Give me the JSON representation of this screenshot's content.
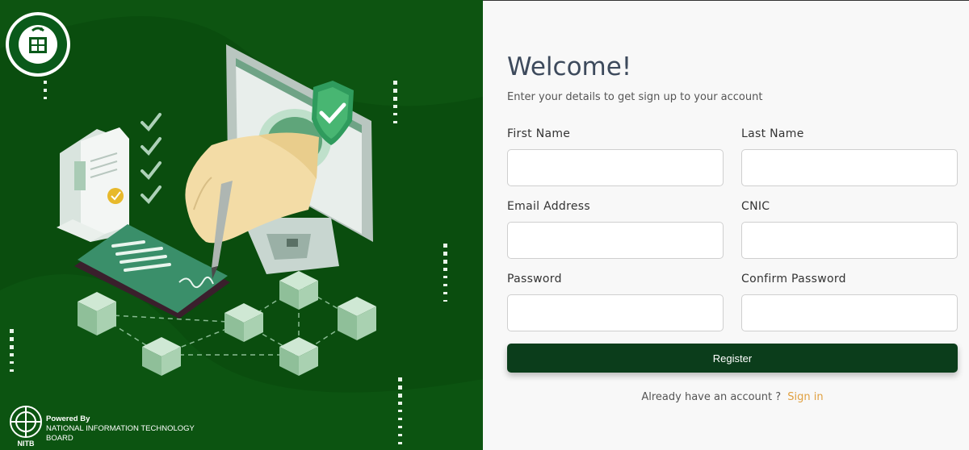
{
  "left": {
    "powered_by": "Powered By",
    "org_name": "NATIONAL INFORMATION TECHNOLOGY",
    "org_name_2": "BOARD",
    "nitb_label": "NITB"
  },
  "form": {
    "title": "Welcome!",
    "subtitle": "Enter your details to get sign up to your account",
    "first_name_label": "First Name",
    "last_name_label": "Last Name",
    "email_label": "Email Address",
    "cnic_label": "CNIC",
    "password_label": "Password",
    "confirm_password_label": "Confirm Password",
    "first_name_value": "",
    "last_name_value": "",
    "email_value": "",
    "cnic_value": "",
    "password_value": "",
    "confirm_password_value": "",
    "register_label": "Register",
    "have_account_text": "Already have an account ?",
    "signin_label": "Sign in"
  },
  "colors": {
    "brand_green": "#0a4d0e",
    "button_green": "#0b3d1b",
    "link_orange": "#e0a040"
  }
}
